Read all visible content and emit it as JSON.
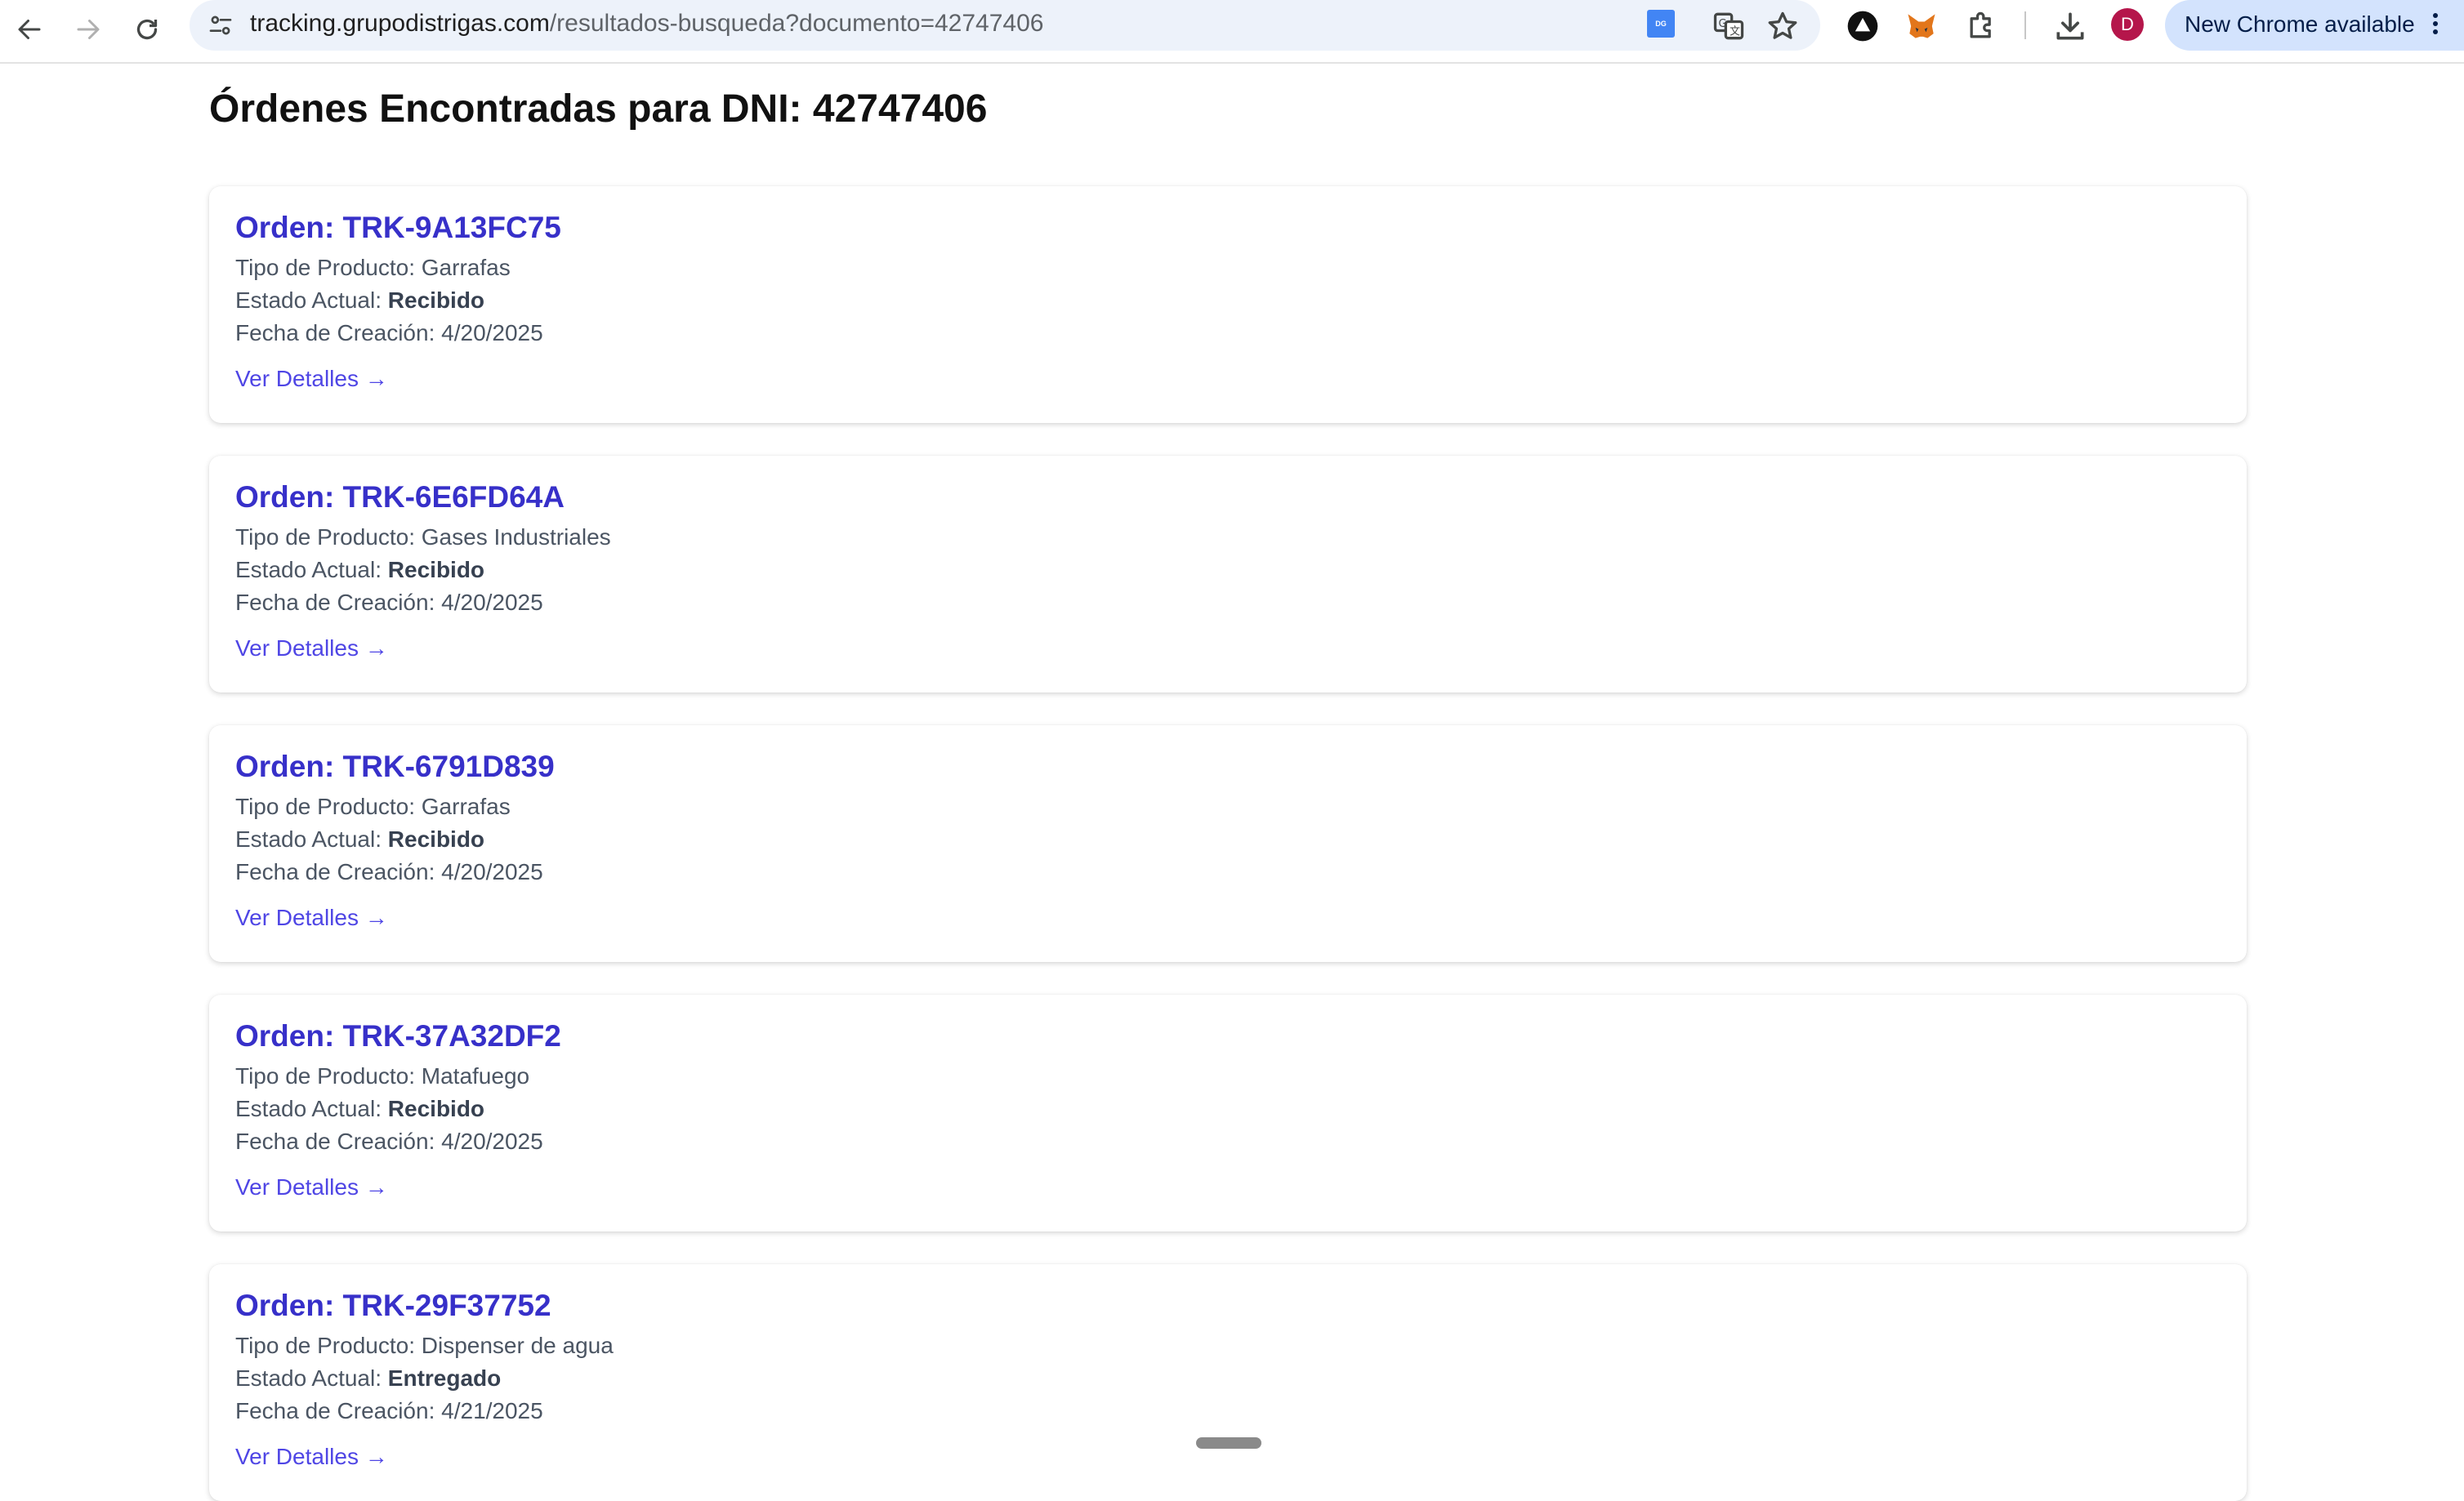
{
  "browser": {
    "url_host": "tracking.grupodistrigas.com",
    "url_path": "/resultados-busqueda?documento=42747406",
    "profile_initial": "D",
    "update_label": "New Chrome available",
    "extension_badge": "DG",
    "icons": [
      "back-icon",
      "forward-icon",
      "reload-icon",
      "site-settings-icon",
      "translate-icon",
      "star-icon",
      "triangle-extension-icon",
      "metamask-fox-icon",
      "extensions-puzzle-icon",
      "download-icon",
      "more-vert-icon"
    ]
  },
  "page": {
    "title": "Órdenes Encontradas para DNI: 42747406",
    "product_label": "Tipo de Producto:",
    "status_label": "Estado Actual:",
    "date_label": "Fecha de Creación:",
    "details_label": "Ver Detalles",
    "details_arrow": "→"
  },
  "orders": [
    {
      "id": "Orden: TRK-9A13FC75",
      "product": "Garrafas",
      "status": "Recibido",
      "date": "4/20/2025"
    },
    {
      "id": "Orden: TRK-6E6FD64A",
      "product": "Gases Industriales",
      "status": "Recibido",
      "date": "4/20/2025"
    },
    {
      "id": "Orden: TRK-6791D839",
      "product": "Garrafas",
      "status": "Recibido",
      "date": "4/20/2025"
    },
    {
      "id": "Orden: TRK-37A32DF2",
      "product": "Matafuego",
      "status": "Recibido",
      "date": "4/20/2025"
    },
    {
      "id": "Orden: TRK-29F37752",
      "product": "Dispenser de agua",
      "status": "Entregado",
      "date": "4/21/2025"
    }
  ],
  "colors": {
    "accent": "#3730c9",
    "link": "#4f46e5",
    "omnibox": "#edf2fa",
    "update_pill": "#d3e3fd",
    "avatar": "#b5164b"
  }
}
